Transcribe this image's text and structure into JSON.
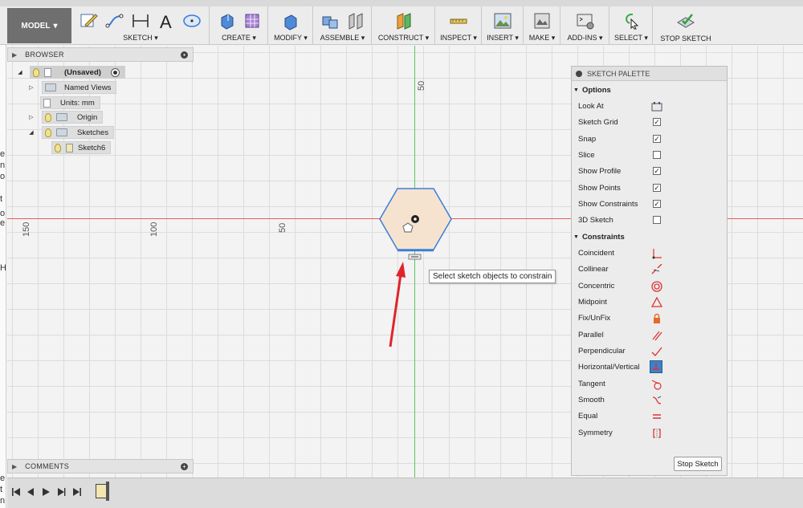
{
  "colors": {
    "accent_blue": "#4a8fd4",
    "axis_green": "#5ec75e",
    "axis_red": "#e06060",
    "arrow_red": "#e0242c",
    "hexagon_fill": "#f6e3cf",
    "hexagon_stroke": "#3b7ed9"
  },
  "toolbar": {
    "model_label": "MODEL",
    "groups": [
      {
        "label": "SKETCH",
        "icons": [
          "create-sketch-icon",
          "spline-icon",
          "dimension-icon",
          "text-icon",
          "ellipse-icon"
        ]
      },
      {
        "label": "CREATE",
        "icons": [
          "extrude-icon",
          "form-icon"
        ]
      },
      {
        "label": "MODIFY",
        "icons": [
          "press-pull-icon"
        ]
      },
      {
        "label": "ASSEMBLE",
        "icons": [
          "new-component-icon",
          "joint-icon"
        ]
      },
      {
        "label": "CONSTRUCT",
        "icons": [
          "offset-plane-icon"
        ]
      },
      {
        "label": "INSPECT",
        "icons": [
          "measure-icon"
        ]
      },
      {
        "label": "INSERT",
        "icons": [
          "insert-image-icon"
        ]
      },
      {
        "label": "MAKE",
        "icons": [
          "make-icon"
        ]
      },
      {
        "label": "ADD-INS",
        "icons": [
          "scripts-icon"
        ]
      },
      {
        "label": "SELECT",
        "icons": [
          "select-icon"
        ]
      },
      {
        "label": "STOP SKETCH",
        "icons": [
          "stop-sketch-icon"
        ]
      }
    ]
  },
  "browser": {
    "title": "BROWSER",
    "items": [
      {
        "label": "(Unsaved)"
      },
      {
        "label": "Named Views"
      },
      {
        "label": "Units: mm"
      },
      {
        "label": "Origin"
      },
      {
        "label": "Sketches"
      },
      {
        "label": "Sketch6"
      }
    ]
  },
  "canvas": {
    "ruler_labels": [
      "50",
      "150",
      "100",
      "50"
    ],
    "tooltip": "Select sketch objects to constrain"
  },
  "palette": {
    "title": "SKETCH PALETTE",
    "options_title": "Options",
    "options": [
      {
        "label": "Look At",
        "control": "icon"
      },
      {
        "label": "Sketch Grid",
        "checked": true
      },
      {
        "label": "Snap",
        "checked": true
      },
      {
        "label": "Slice",
        "checked": false
      },
      {
        "label": "Show Profile",
        "checked": true
      },
      {
        "label": "Show Points",
        "checked": true
      },
      {
        "label": "Show Constraints",
        "checked": true
      },
      {
        "label": "3D Sketch",
        "checked": false
      }
    ],
    "constraints_title": "Constraints",
    "constraints": [
      {
        "label": "Coincident",
        "icon": "coincident-icon"
      },
      {
        "label": "Collinear",
        "icon": "collinear-icon"
      },
      {
        "label": "Concentric",
        "icon": "concentric-icon"
      },
      {
        "label": "Midpoint",
        "icon": "midpoint-icon"
      },
      {
        "label": "Fix/UnFix",
        "icon": "fix-icon"
      },
      {
        "label": "Parallel",
        "icon": "parallel-icon"
      },
      {
        "label": "Perpendicular",
        "icon": "perpendicular-icon"
      },
      {
        "label": "Horizontal/Vertical",
        "icon": "horizontal-vertical-icon",
        "active": true
      },
      {
        "label": "Tangent",
        "icon": "tangent-icon"
      },
      {
        "label": "Smooth",
        "icon": "smooth-icon"
      },
      {
        "label": "Equal",
        "icon": "equal-icon"
      },
      {
        "label": "Symmetry",
        "icon": "symmetry-icon"
      }
    ],
    "stop_label": "Stop Sketch"
  },
  "comments": {
    "title": "COMMENTS"
  },
  "timeline": {
    "controls": [
      "skip-start-icon",
      "step-back-icon",
      "play-icon",
      "step-forward-icon",
      "skip-end-icon"
    ]
  }
}
